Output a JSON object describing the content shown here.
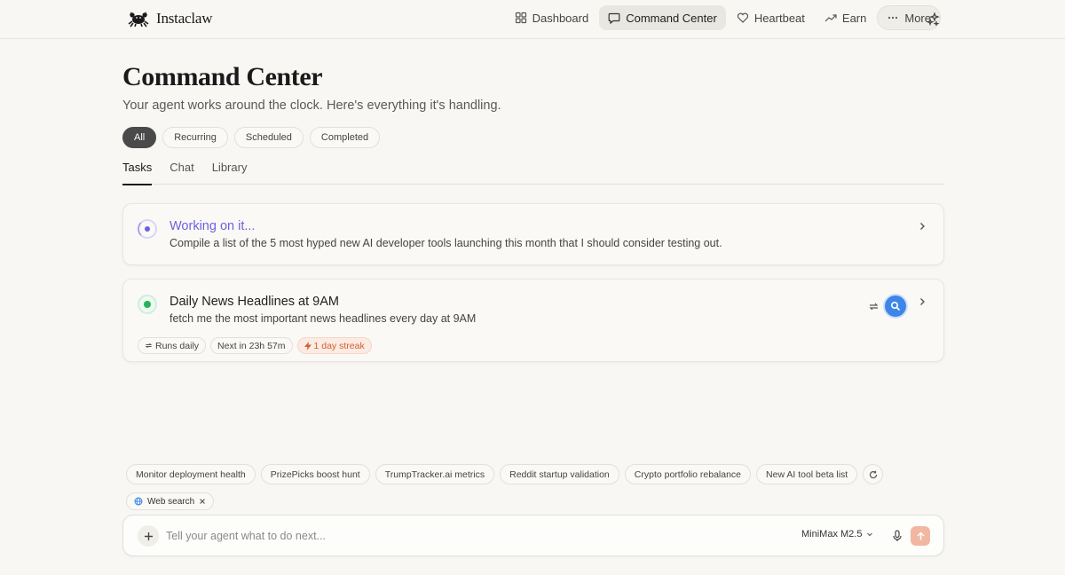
{
  "brand": {
    "name": "Instaclaw"
  },
  "nav": {
    "dashboard": "Dashboard",
    "command_center": "Command Center",
    "heartbeat": "Heartbeat",
    "earn": "Earn",
    "more": "More"
  },
  "page": {
    "title": "Command Center",
    "subtitle": "Your agent works around the clock. Here's everything it's handling."
  },
  "filters": [
    "All",
    "Recurring",
    "Scheduled",
    "Completed"
  ],
  "tabs": [
    "Tasks",
    "Chat",
    "Library"
  ],
  "tasks": [
    {
      "title": "Working on it...",
      "description": "Compile a list of the 5 most hyped new AI developer tools launching this month that I should consider testing out."
    },
    {
      "title": "Daily News Headlines at 9AM",
      "description": "fetch me the most important news headlines every day at 9AM",
      "tags": {
        "schedule": "Runs daily",
        "next": "Next in 23h 57m",
        "streak": "1 day streak"
      }
    }
  ],
  "suggestions": [
    "Monitor deployment health",
    "PrizePicks boost hunt",
    "TrumpTracker.ai metrics",
    "Reddit startup validation",
    "Crypto portfolio rebalance",
    "New AI tool beta list"
  ],
  "tool": {
    "label": "Web search"
  },
  "composer": {
    "placeholder": "Tell your agent what to do next...",
    "model": "MiniMax M2.5"
  },
  "colors": {
    "accent_purple": "#6b62e0",
    "status_green": "#22b455",
    "search_blue": "#3d86e8",
    "streak_orange": "#d0602e",
    "send_peach": "#f2b7a0"
  }
}
